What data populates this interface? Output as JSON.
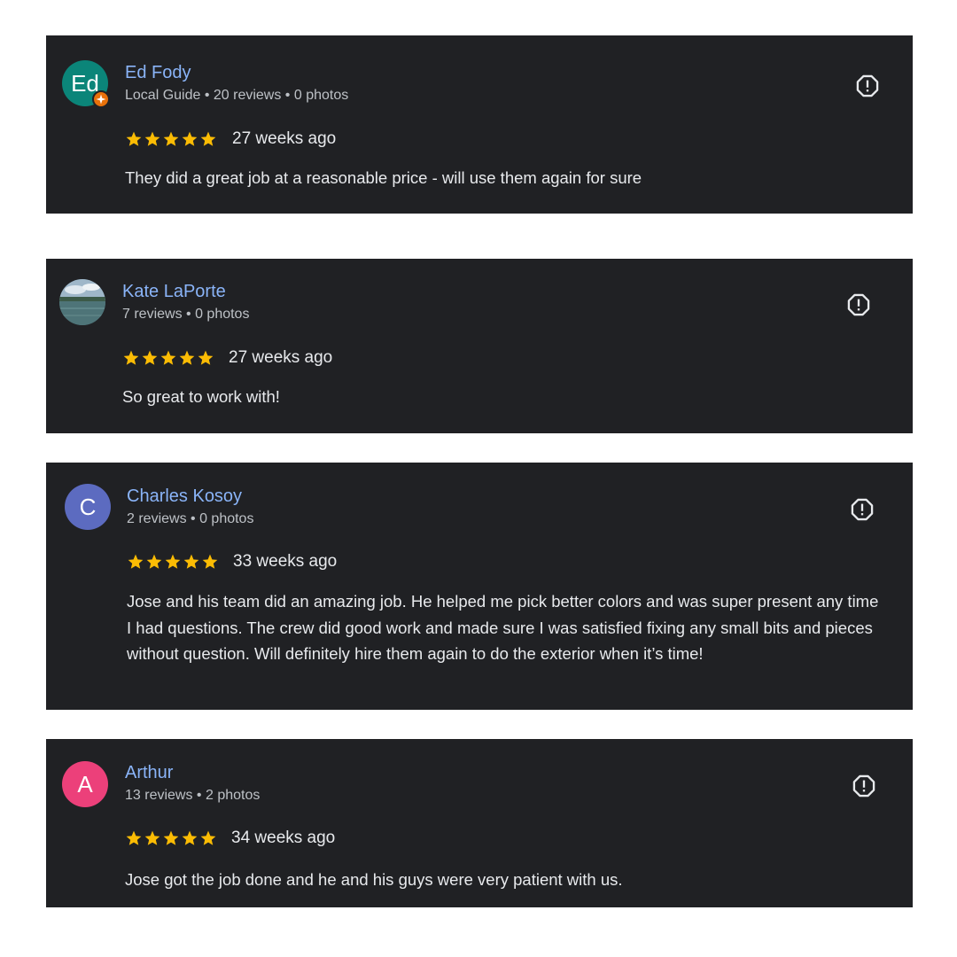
{
  "colors": {
    "card_bg": "#202124",
    "name": "#8ab4f8",
    "meta": "#bdc1c6",
    "text": "#e8eaed",
    "star": "#fbbc04",
    "guide_badge": "#e8710a"
  },
  "reviews": [
    {
      "name": "Ed Fody",
      "avatar_text": "Ed",
      "avatar_color": "#0b8579",
      "meta": "Local Guide • 20 reviews • 0 photos",
      "rating": 5,
      "time": "27 weeks ago",
      "text": "They did a great job at a reasonable price - will use them again for sure"
    },
    {
      "name": "Kate LaPorte",
      "avatar_text": "",
      "avatar_color": "#4a6f7a",
      "meta": "7 reviews • 0 photos",
      "rating": 5,
      "time": "27 weeks ago",
      "text": "So great to work with!"
    },
    {
      "name": "Charles Kosoy",
      "avatar_text": "C",
      "avatar_color": "#5c6bc0",
      "meta": "2 reviews • 0 photos",
      "rating": 5,
      "time": "33 weeks ago",
      "text": "Jose and his team did an amazing job. He helped me pick better colors and was super present any time I had questions. The crew did good work and made sure I was satisfied fixing any small bits and pieces without question. Will definitely hire them again to do the exterior when it’s time!"
    },
    {
      "name": "Arthur",
      "avatar_text": "A",
      "avatar_color": "#ec407a",
      "meta": "13 reviews • 2 photos",
      "rating": 5,
      "time": "34 weeks ago",
      "text": "Jose got the job done and he and his guys were very patient with us."
    }
  ],
  "icons": {
    "star": "star-icon",
    "report": "report-flag-icon",
    "guide": "local-guide-badge-icon"
  }
}
